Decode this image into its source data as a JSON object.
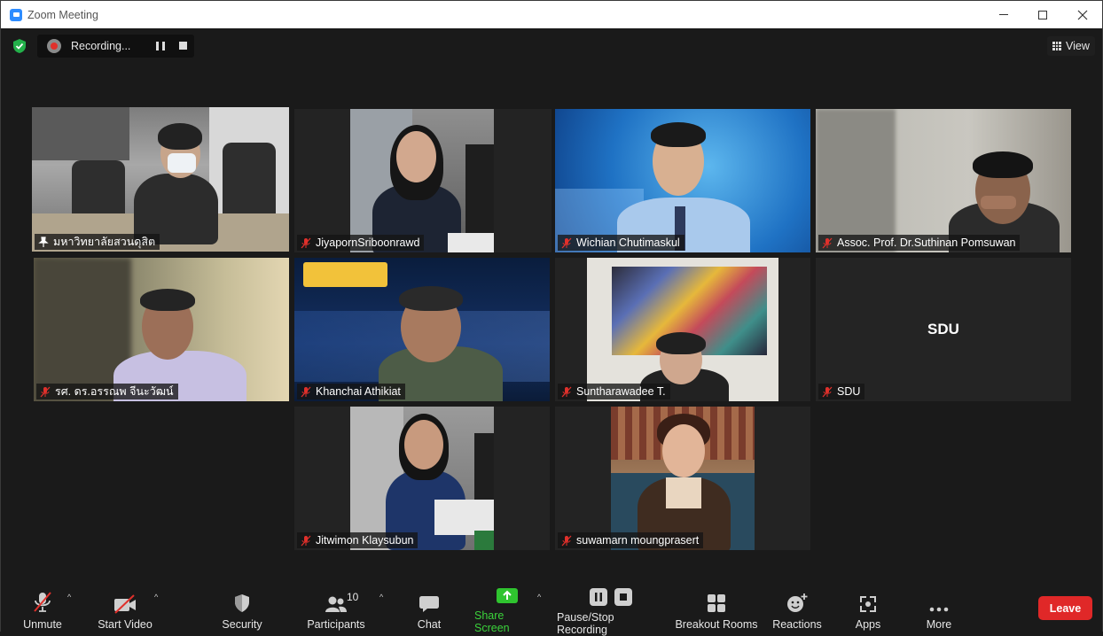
{
  "window": {
    "title": "Zoom Meeting"
  },
  "recording": {
    "label": "Recording..."
  },
  "view_button": {
    "label": "View"
  },
  "tiles": [
    {
      "name": "มหาวิทยาลัยสวนดุสิต",
      "status": "pinned",
      "active": true
    },
    {
      "name": "JiyapornSriboonrawd",
      "status": "muted"
    },
    {
      "name": "Wichian Chutimaskul",
      "status": "muted"
    },
    {
      "name": "Assoc. Prof. Dr.Suthinan Pomsuwan",
      "status": "muted"
    },
    {
      "name": "รศ. ดร.อรรณพ จีนะวัฒน์",
      "status": "muted"
    },
    {
      "name": "Khanchai Athikiat",
      "status": "muted"
    },
    {
      "name": "Suntharawadee T.",
      "status": "muted"
    },
    {
      "name": "SDU",
      "status": "muted",
      "video_off_label": "SDU"
    },
    {
      "name": "Jitwimon Klaysubun",
      "status": "muted"
    },
    {
      "name": "suwamarn moungprasert",
      "status": "muted"
    }
  ],
  "toolbar": {
    "unmute": "Unmute",
    "start_video": "Start Video",
    "security": "Security",
    "participants": "Participants",
    "participants_count": "10",
    "chat": "Chat",
    "share_screen": "Share Screen",
    "pause_stop_recording": "Pause/Stop Recording",
    "breakout_rooms": "Breakout Rooms",
    "reactions": "Reactions",
    "apps": "Apps",
    "more": "More",
    "leave": "Leave"
  },
  "colors": {
    "active_speaker_border": "#bfe352",
    "share_screen_green": "#3bd33b",
    "leave_red": "#e02828",
    "muted_red": "#e0302b"
  }
}
